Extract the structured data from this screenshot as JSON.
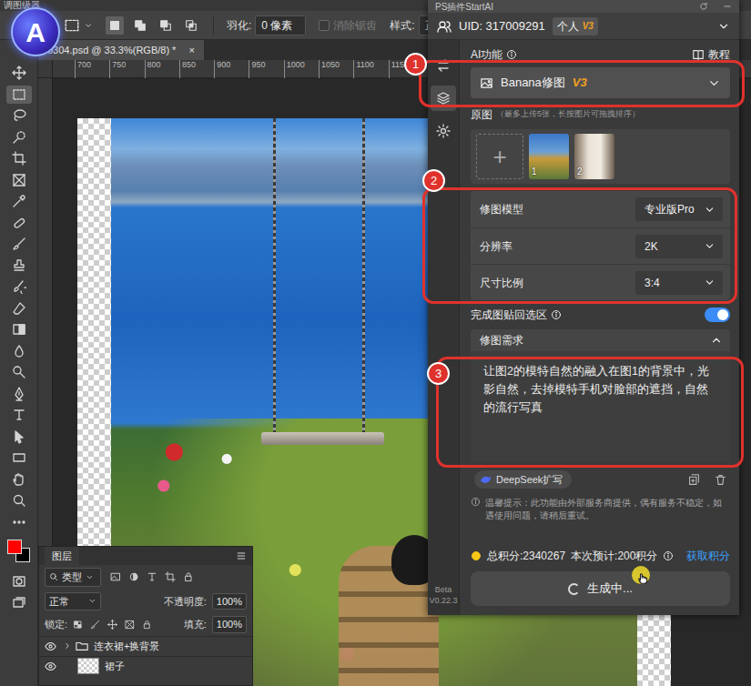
{
  "app": {
    "title": "调图级器",
    "logo": "A"
  },
  "options_bar": {
    "modes": [
      {
        "selected": true
      },
      {
        "selected": false
      },
      {
        "selected": false
      },
      {
        "selected": false
      }
    ],
    "feather_label": "羽化:",
    "feather_value": "0 像素",
    "antialias": {
      "label": "消除锯齿",
      "checked": false,
      "disabled": true
    },
    "style_label": "样式:",
    "style_value": "正常"
  },
  "document": {
    "tab": "0304.psd @ 33.3%(RGB/8) *",
    "close": "×",
    "ruler": [
      "700",
      "750",
      "800",
      "850",
      "900",
      "950",
      "1000",
      "1050",
      "1100",
      "1150"
    ]
  },
  "tools": [
    {
      "kind": "move",
      "selected": false
    },
    {
      "kind": "marquee",
      "selected": true
    },
    {
      "kind": "lasso",
      "selected": false
    },
    {
      "kind": "quick-select",
      "selected": false
    },
    {
      "kind": "crop",
      "selected": false
    },
    {
      "kind": "frame",
      "selected": false
    },
    {
      "kind": "eyedropper",
      "selected": false
    },
    {
      "kind": "heal",
      "selected": false
    },
    {
      "kind": "brush",
      "selected": false
    },
    {
      "kind": "stamp",
      "selected": false
    },
    {
      "kind": "history",
      "selected": false
    },
    {
      "kind": "eraser",
      "selected": false
    },
    {
      "kind": "gradient",
      "selected": false
    },
    {
      "kind": "blur",
      "selected": false
    },
    {
      "kind": "dodge",
      "selected": false
    },
    {
      "kind": "pen",
      "selected": false
    },
    {
      "kind": "type",
      "selected": false
    },
    {
      "kind": "path-select",
      "selected": false
    },
    {
      "kind": "shape",
      "selected": false
    },
    {
      "kind": "hand",
      "selected": false
    },
    {
      "kind": "zoom",
      "selected": false
    },
    {
      "kind": "more",
      "selected": false
    }
  ],
  "colors": {
    "foreground": "#ff0000",
    "background": "#000000"
  },
  "view_tools": [
    {
      "kind": "quick-mask",
      "selected": false
    },
    {
      "kind": "screen-mode",
      "selected": false
    }
  ],
  "layers_panel": {
    "title": "图层",
    "filter": "类型",
    "blend": "正常",
    "opacity_label": "不透明度:",
    "opacity": "100%",
    "lock_label": "锁定:",
    "fill_label": "填充:",
    "fill": "100%",
    "layers": [
      {
        "name": "连衣裙+换背景",
        "kind": "group",
        "visible": true,
        "selected": false
      },
      {
        "name": "裙子",
        "kind": "layer",
        "visible": true,
        "selected": false
      }
    ]
  },
  "plugin": {
    "title": "PS插件StartAI",
    "uid": "UID: 317009291",
    "account": "个人",
    "account_badge": "V3",
    "rail": [
      {
        "kind": "swap",
        "selected": false
      },
      {
        "kind": "layers",
        "selected": true
      },
      {
        "kind": "settings",
        "selected": false
      }
    ],
    "version": [
      "Beta",
      "V0.22.3"
    ],
    "ai_label": "AI功能",
    "tutorial": "教程",
    "feature": {
      "name": "Banana修图",
      "badge": "V3"
    },
    "source_label": "原图",
    "source_hint": "（最多上传5张，长按图片可拖拽排序）",
    "add": "+",
    "images": [
      {
        "index": "1"
      },
      {
        "index": "2"
      }
    ],
    "settings": [
      {
        "label": "修图模型",
        "value": "专业版Pro"
      },
      {
        "label": "分辨率",
        "value": "2K"
      },
      {
        "label": "尺寸比例",
        "value": "3:4"
      }
    ],
    "paste_back": {
      "label": "完成图贴回选区",
      "on": true
    },
    "request": {
      "title": "修图需求",
      "expanded": true,
      "text": "让图2的模特自然的融入在图1的背景中，光影自然，去掉模特手机对脸部的遮挡，自然的流行写真",
      "expand_button": "DeepSeek扩写"
    },
    "notice": "温馨提示：此功能由外部服务商提供，偶有服务不稳定，如遇使用问题，请稍后重试。",
    "points": {
      "total": "总积分:2340267",
      "estimate": "本次预计:200积分",
      "get": "获取积分"
    },
    "generate": {
      "label": "生成中...",
      "busy": true
    }
  },
  "annotations": [
    {
      "number": "1"
    },
    {
      "number": "2"
    },
    {
      "number": "3"
    }
  ]
}
